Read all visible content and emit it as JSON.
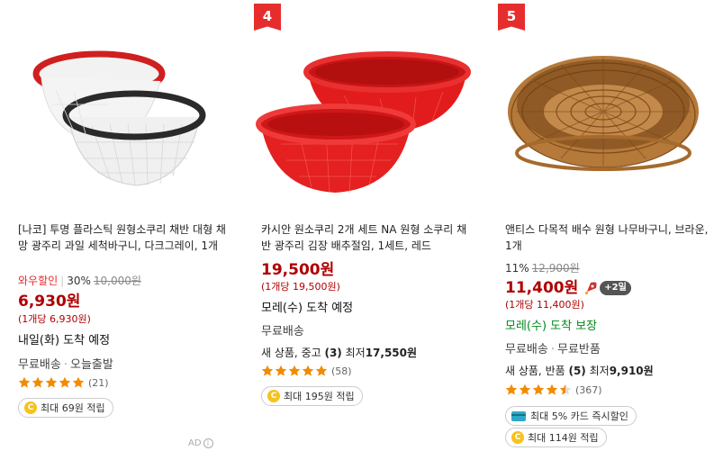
{
  "colors": {
    "price_red": "#ae0000",
    "badge_red": "#e62d2d",
    "delivery_green": "#00891a",
    "star_orange": "#f28b00",
    "coin_yellow": "#f6c21d"
  },
  "products": [
    {
      "rank": "",
      "image": "clear-white-and-black-rim-plastic-colanders",
      "title": "[나코] 투명 플라스틱 원형소쿠리 채반 대형 채망 광주리 과일 세척바구니, 다크그레이, 1개",
      "wow_label": "와우할인",
      "discount": "30%",
      "original_price": "10,000원",
      "price": "6,930원",
      "unit_price": "(1개당 6,930원)",
      "delivery": "내일(화) 도착 예정",
      "shipping": [
        "무료배송",
        "오늘출발"
      ],
      "used_text": "",
      "rating": 5,
      "reviews": "(21)",
      "card_promo": "",
      "points": "최대 69원 적립"
    },
    {
      "rank": "4",
      "image": "red-plastic-colanders-set",
      "title": "카시안 원소쿠리 2개 세트 NA 원형 소쿠리 채반 광주리 김장 배추절임, 1세트, 레드",
      "wow_label": "",
      "discount": "",
      "original_price": "",
      "price": "19,500원",
      "unit_price": "(1개당 19,500원)",
      "delivery": "모레(수) 도착 예정",
      "shipping": [
        "무료배송"
      ],
      "used_prefix": "새 상품, 중고 ",
      "used_count": "(3)",
      "used_mid": " 최저",
      "used_price": "17,550원",
      "rating": 5,
      "reviews": "(58)",
      "card_promo": "",
      "points": "최대 195원 적립"
    },
    {
      "rank": "5",
      "image": "brown-woven-rattan-basket",
      "title": "앤티스 다목적 배수 원형 나무바구니, 브라운, 1개",
      "wow_label": "",
      "discount": "11%",
      "original_price": "12,900원",
      "price": "11,400원",
      "rocket_badge": "+2일",
      "unit_price": "(1개당 11,400원)",
      "delivery": "모레(수) 도착 보장",
      "shipping": [
        "무료배송",
        "무료반품"
      ],
      "used_prefix": "새 상품, 반품 ",
      "used_count": "(5)",
      "used_mid": " 최저",
      "used_price": "9,910원",
      "rating": 4.5,
      "reviews": "(367)",
      "card_promo": "최대 5% 카드 즉시할인",
      "points": "최대 114원 적립"
    }
  ],
  "ad_label": "AD",
  "ad_info": "i"
}
